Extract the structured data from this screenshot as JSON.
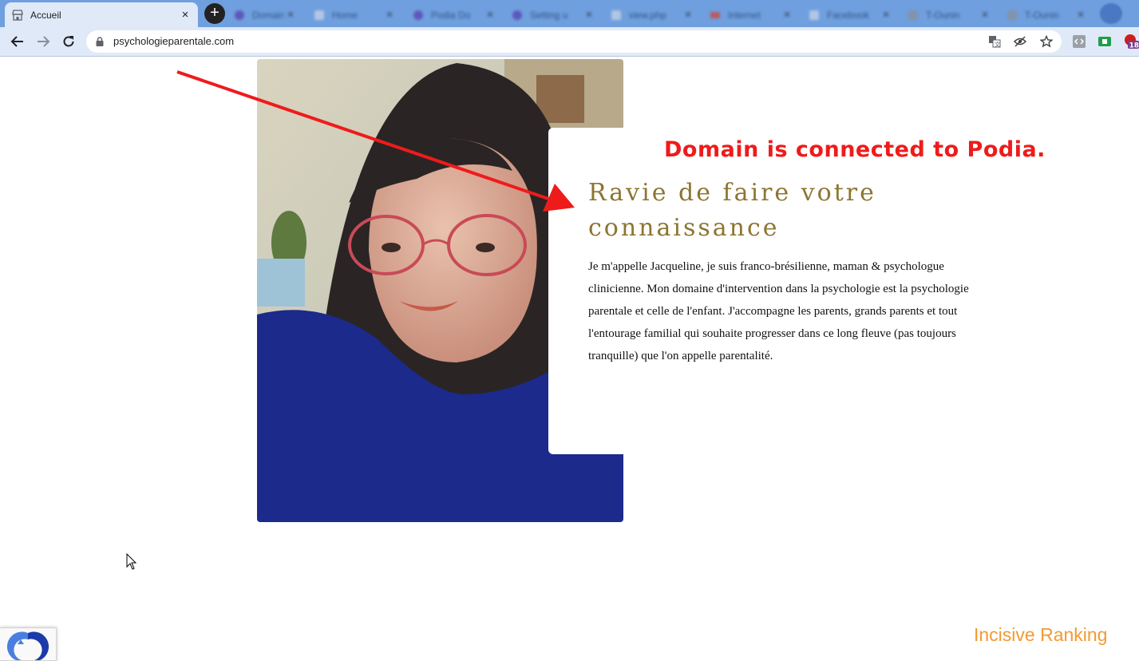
{
  "browser": {
    "active_tab": {
      "title": "Accueil",
      "close_glyph": "×",
      "icon": "store-icon"
    },
    "new_tab_glyph": "+",
    "background_tabs": [
      {
        "title": "Domain M",
        "icon": "podia-icon"
      },
      {
        "title": "Home",
        "icon": "page-icon"
      },
      {
        "title": "Podia Do",
        "icon": "podia-icon"
      },
      {
        "title": "Setting u",
        "icon": "podia-icon"
      },
      {
        "title": "view.php",
        "icon": "page-icon"
      },
      {
        "title": "Internet",
        "icon": "flag-icon"
      },
      {
        "title": "Facebook",
        "icon": "page-icon"
      },
      {
        "title": "T-Ounin",
        "icon": "page-icon"
      },
      {
        "title": "T-Ounin",
        "icon": "page-icon"
      }
    ],
    "tab_close_glyph": "×",
    "toolbar": {
      "url": "psychologieparentale.com",
      "extension_badge": "18"
    }
  },
  "page": {
    "heading": "Ravie de faire votre connaissance",
    "bio": "Je m'appelle Jacqueline, je suis franco-brésilienne, maman & psychologue clinicienne. Mon domaine d'intervention dans la psychologie est la psychologie parentale et celle de l'enfant. J'accompagne les parents, grands parents et tout l'entourage familial qui souhaite progresser dans ce long fleuve (pas toujours tranquille) que l'on appelle parentalité."
  },
  "overlay": {
    "annotation": "Domain is connected to Podia.",
    "watermark": "Incisive Ranking"
  },
  "colors": {
    "tab_strip": "#6f9fde",
    "toolbar": "#dfe9f8",
    "heading": "#8c7530",
    "annotation": "#ef1b1b",
    "watermark": "#f39a32"
  }
}
